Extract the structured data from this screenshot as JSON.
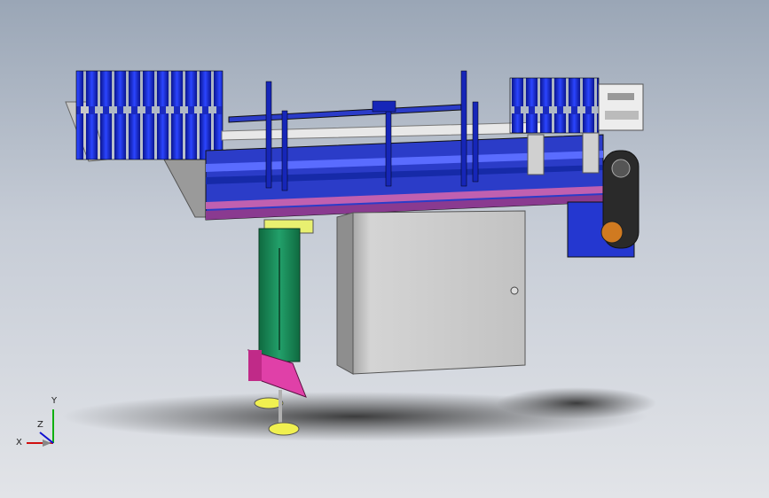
{
  "triad": {
    "x_label": "X",
    "y_label": "Y",
    "z_label": "Z"
  },
  "colors": {
    "bottle_blue": "#1f2fd0",
    "frame_blue": "#2b3cc8",
    "rail_magenta": "#c060b0",
    "cabinet_gray": "#c9c9c9",
    "leg_green": "#1f8a5a",
    "foot_pink": "#e040a8",
    "pad_yellow": "#f0f050"
  }
}
